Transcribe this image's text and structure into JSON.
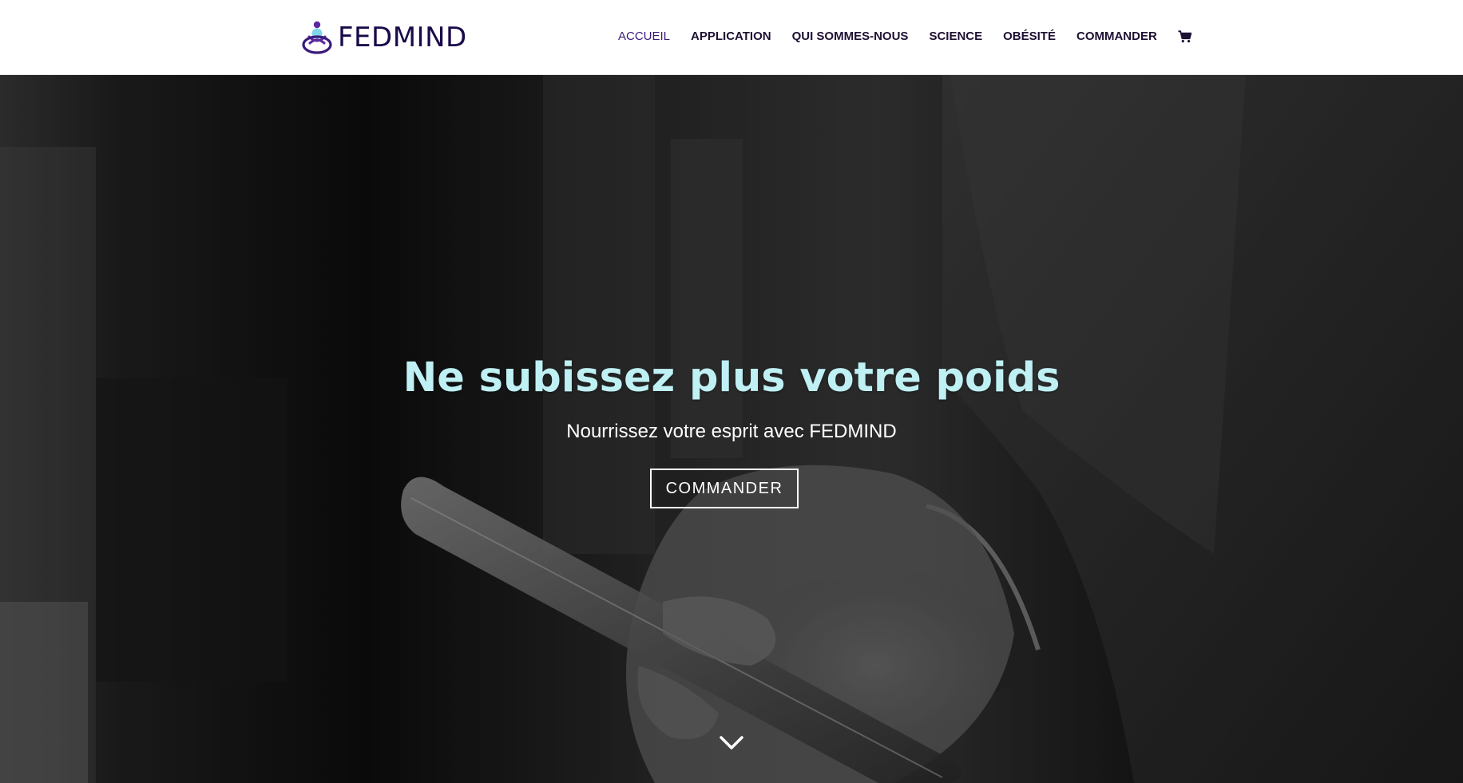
{
  "brand": {
    "name": "FEDMIND",
    "colors": {
      "primary": "#1a0a4a",
      "accent_purple": "#5b2a9e",
      "hero_title": "#bff0f4"
    }
  },
  "nav": {
    "items": [
      {
        "label": "ACCUEIL",
        "active": true
      },
      {
        "label": "APPLICATION",
        "active": false
      },
      {
        "label": "QUI SOMMES-NOUS",
        "active": false
      },
      {
        "label": "SCIENCE",
        "active": false
      },
      {
        "label": "OBÉSITÉ",
        "active": false
      },
      {
        "label": "COMMANDER",
        "active": false
      }
    ],
    "cart_icon": "shopping-cart-icon"
  },
  "hero": {
    "title": "Ne subissez plus votre poids",
    "subtitle": "Nourrissez votre esprit avec FEDMIND",
    "button_label": "COMMANDER",
    "scroll_icon": "chevron-down-icon"
  }
}
